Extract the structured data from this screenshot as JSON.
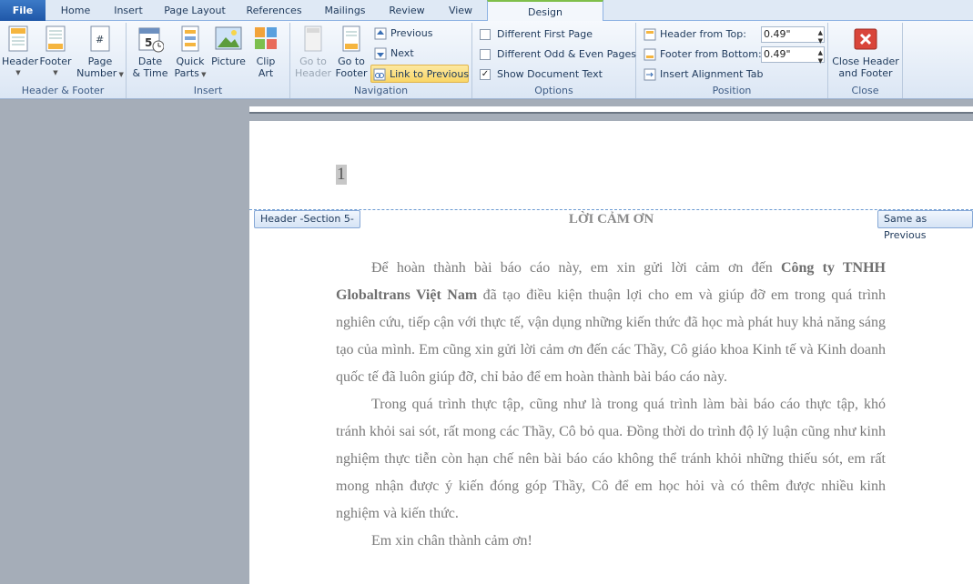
{
  "tabs": {
    "file": "File",
    "home": "Home",
    "insert": "Insert",
    "page_layout": "Page Layout",
    "references": "References",
    "mailings": "Mailings",
    "review": "Review",
    "view": "View",
    "design": "Design"
  },
  "groups": {
    "header_footer": "Header & Footer",
    "insert": "Insert",
    "navigation": "Navigation",
    "options": "Options",
    "position": "Position",
    "close": "Close"
  },
  "buttons": {
    "header": "Header",
    "footer": "Footer",
    "page_number_1": "Page",
    "page_number_2": "Number",
    "date_time_1": "Date",
    "date_time_2": "& Time",
    "quick_parts_1": "Quick",
    "quick_parts_2": "Parts",
    "picture": "Picture",
    "clip_art_1": "Clip",
    "clip_art_2": "Art",
    "go_to_header_1": "Go to",
    "go_to_header_2": "Header",
    "go_to_footer_1": "Go to",
    "go_to_footer_2": "Footer",
    "previous": "Previous",
    "next": "Next",
    "link_to_previous": "Link to Previous",
    "close_1": "Close Header",
    "close_2": "and Footer"
  },
  "options": {
    "different_first_page": "Different First Page",
    "different_odd_even": "Different Odd & Even Pages",
    "show_document_text": "Show Document Text",
    "checked_mark": "✓"
  },
  "position": {
    "header_from_top_label": "Header from Top:",
    "header_from_top_value": "0.49\"",
    "footer_from_bottom_label": "Footer from Bottom:",
    "footer_from_bottom_value": "0.49\"",
    "insert_alignment_tab": "Insert Alignment Tab"
  },
  "document": {
    "header_number": "1",
    "header_tag": "Header -Section 5-",
    "same_as_previous": "Same as Previous",
    "title": "LỜI CẢM ƠN",
    "p1_a": "Để hoàn thành bài báo cáo này, em xin gửi lời cảm ơn đến ",
    "p1_bold": "Công ty TNHH Globaltrans Việt Nam",
    "p1_b": "  đã tạo điều kiện thuận lợi cho em và giúp đỡ em trong quá trình nghiên cứu, tiếp cận với thực tế, vận dụng những kiến thức đã học mà phát huy khả năng sáng tạo của mình. Em cũng xin gửi lời cảm ơn đến các Thầy, Cô giáo khoa Kinh tế và Kinh doanh quốc tế đã luôn giúp đỡ, chỉ bảo để em hoàn thành bài báo cáo này.",
    "p2": "Trong quá trình thực tập, cũng như là trong quá trình làm bài báo cáo thực tập, khó tránh khỏi sai sót, rất mong các Thầy, Cô bỏ qua. Đồng thời do trình độ lý luận cũng như kinh nghiệm thực tiễn còn hạn chế nên bài báo cáo không thể tránh khỏi những thiếu sót, em rất mong nhận được ý kiến đóng góp Thầy, Cô để em học hỏi và có thêm được nhiều kinh nghiệm và kiến thức.",
    "p3": "Em xin chân thành cảm ơn!"
  }
}
